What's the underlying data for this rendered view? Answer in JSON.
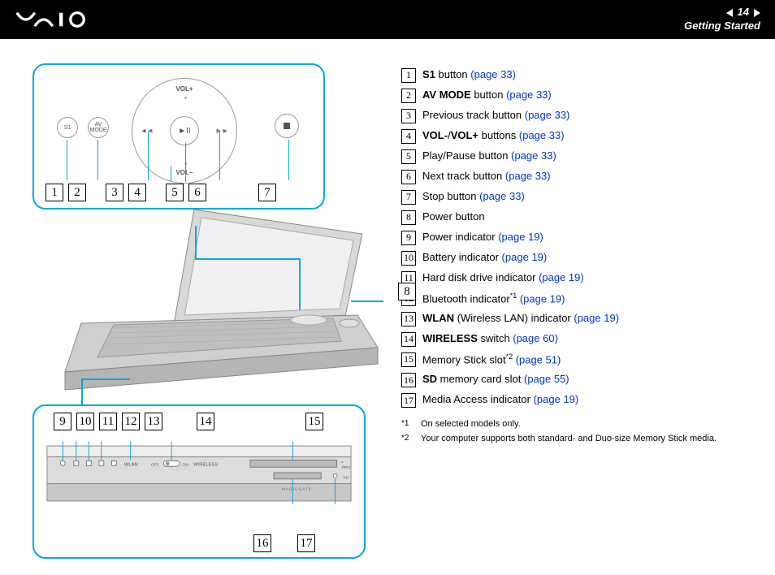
{
  "header": {
    "page_number": "14",
    "section": "Getting Started"
  },
  "top_callout": {
    "s1_label": "S1",
    "av_label": "AV\nMODE",
    "vol_plus": "VOL+",
    "vol_minus": "VOL−",
    "prev": "◄◄",
    "next": "►►",
    "playpause": "►II",
    "numbers": [
      "1",
      "2",
      "3",
      "4",
      "5",
      "6",
      "7"
    ]
  },
  "num8": "8",
  "bottom_callout": {
    "top_numbers": [
      "9",
      "10",
      "11",
      "12",
      "13",
      "14",
      "15"
    ],
    "bottom_numbers": [
      "16",
      "17"
    ],
    "panel_labels": {
      "wlan": "WLAN",
      "off": "OFF",
      "on": "ON",
      "wireless": "WIRELESS",
      "pro": "PRO",
      "sd": "SD",
      "magicgate": "MAGICGATE"
    }
  },
  "items": [
    {
      "n": "1",
      "parts": [
        {
          "t": "S1",
          "b": true
        },
        {
          "t": " button "
        },
        {
          "t": "(page 33)",
          "link": true
        }
      ]
    },
    {
      "n": "2",
      "parts": [
        {
          "t": "AV MODE",
          "b": true
        },
        {
          "t": " button "
        },
        {
          "t": "(page 33)",
          "link": true
        }
      ]
    },
    {
      "n": "3",
      "parts": [
        {
          "t": "Previous track button "
        },
        {
          "t": "(page 33)",
          "link": true
        }
      ]
    },
    {
      "n": "4",
      "parts": [
        {
          "t": "VOL-",
          "b": true
        },
        {
          "t": "/"
        },
        {
          "t": "VOL+",
          "b": true
        },
        {
          "t": " buttons "
        },
        {
          "t": "(page 33)",
          "link": true
        }
      ]
    },
    {
      "n": "5",
      "parts": [
        {
          "t": "Play/Pause button "
        },
        {
          "t": "(page 33)",
          "link": true
        }
      ]
    },
    {
      "n": "6",
      "parts": [
        {
          "t": "Next track button "
        },
        {
          "t": "(page 33)",
          "link": true
        }
      ]
    },
    {
      "n": "7",
      "parts": [
        {
          "t": "Stop button "
        },
        {
          "t": "(page 33)",
          "link": true
        }
      ]
    },
    {
      "n": "8",
      "parts": [
        {
          "t": "Power button"
        }
      ]
    },
    {
      "n": "9",
      "parts": [
        {
          "t": "Power indicator "
        },
        {
          "t": "(page 19)",
          "link": true
        }
      ]
    },
    {
      "n": "10",
      "parts": [
        {
          "t": "Battery indicator "
        },
        {
          "t": "(page 19)",
          "link": true
        }
      ]
    },
    {
      "n": "11",
      "parts": [
        {
          "t": "Hard disk drive indicator "
        },
        {
          "t": "(page 19)",
          "link": true
        }
      ]
    },
    {
      "n": "12",
      "parts": [
        {
          "t": "Bluetooth indicator"
        },
        {
          "t": "*1",
          "sup": true
        },
        {
          "t": " "
        },
        {
          "t": "(page 19)",
          "link": true
        }
      ]
    },
    {
      "n": "13",
      "parts": [
        {
          "t": "WLAN",
          "b": true
        },
        {
          "t": " (Wireless LAN) indicator "
        },
        {
          "t": "(page 19)",
          "link": true
        }
      ]
    },
    {
      "n": "14",
      "parts": [
        {
          "t": "WIRELESS",
          "b": true
        },
        {
          "t": " switch "
        },
        {
          "t": "(page 60)",
          "link": true
        }
      ]
    },
    {
      "n": "15",
      "parts": [
        {
          "t": "Memory Stick slot"
        },
        {
          "t": "*2",
          "sup": true
        },
        {
          "t": " "
        },
        {
          "t": "(page 51)",
          "link": true
        }
      ]
    },
    {
      "n": "16",
      "parts": [
        {
          "t": "SD",
          "b": true
        },
        {
          "t": " memory card slot "
        },
        {
          "t": "(page 55)",
          "link": true
        }
      ]
    },
    {
      "n": "17",
      "parts": [
        {
          "t": "Media Access indicator "
        },
        {
          "t": "(page 19)",
          "link": true
        }
      ]
    }
  ],
  "footnotes": [
    {
      "mark": "*1",
      "text": "On selected models only."
    },
    {
      "mark": "*2",
      "text": "Your computer supports both standard- and Duo-size Memory Stick media."
    }
  ]
}
